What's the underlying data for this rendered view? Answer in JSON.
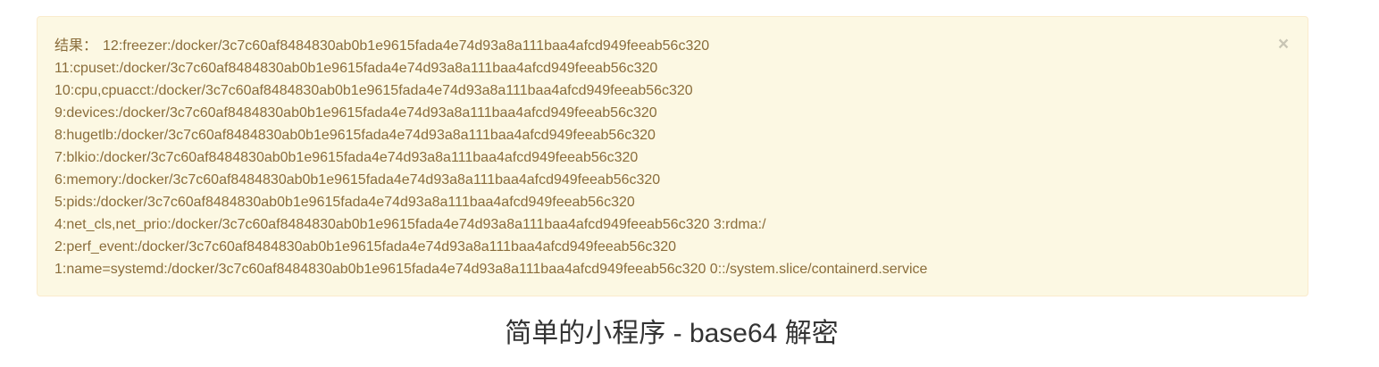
{
  "alert": {
    "result_label": "结果：",
    "close_glyph": "×",
    "lines": [
      "12:freezer:/docker/3c7c60af8484830ab0b1e9615fada4e74d93a8a111baa4afcd949feeab56c320",
      "11:cpuset:/docker/3c7c60af8484830ab0b1e9615fada4e74d93a8a111baa4afcd949feeab56c320",
      "10:cpu,cpuacct:/docker/3c7c60af8484830ab0b1e9615fada4e74d93a8a111baa4afcd949feeab56c320",
      "9:devices:/docker/3c7c60af8484830ab0b1e9615fada4e74d93a8a111baa4afcd949feeab56c320",
      "8:hugetlb:/docker/3c7c60af8484830ab0b1e9615fada4e74d93a8a111baa4afcd949feeab56c320",
      "7:blkio:/docker/3c7c60af8484830ab0b1e9615fada4e74d93a8a111baa4afcd949feeab56c320",
      "6:memory:/docker/3c7c60af8484830ab0b1e9615fada4e74d93a8a111baa4afcd949feeab56c320",
      "5:pids:/docker/3c7c60af8484830ab0b1e9615fada4e74d93a8a111baa4afcd949feeab56c320",
      "4:net_cls,net_prio:/docker/3c7c60af8484830ab0b1e9615fada4e74d93a8a111baa4afcd949feeab56c320 3:rdma:/",
      "2:perf_event:/docker/3c7c60af8484830ab0b1e9615fada4e74d93a8a111baa4afcd949feeab56c320",
      "1:name=systemd:/docker/3c7c60af8484830ab0b1e9615fada4e74d93a8a111baa4afcd949feeab56c320 0::/system.slice/containerd.service"
    ]
  },
  "page": {
    "title": "简单的小程序 - base64 解密"
  },
  "colors": {
    "alert_background": "#fcf8e3",
    "alert_border": "#faebcc",
    "alert_text": "#8a6d3b",
    "title_text": "#333333"
  }
}
